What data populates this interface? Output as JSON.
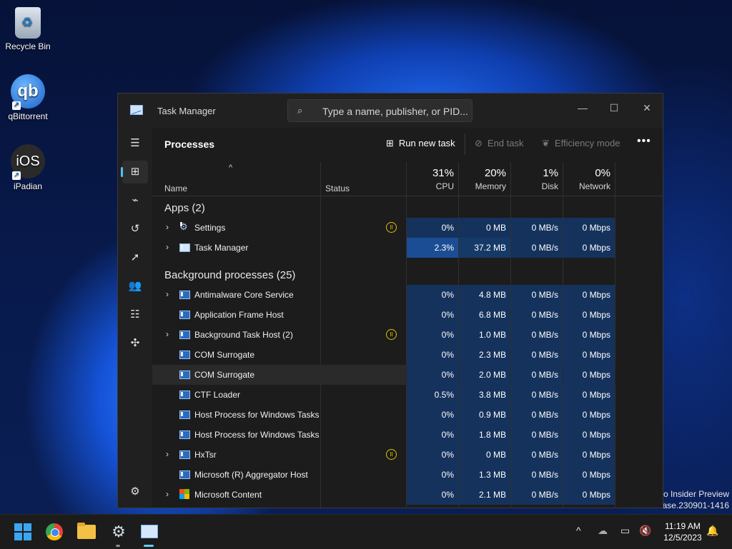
{
  "desktop": {
    "icons": [
      {
        "label": "Recycle Bin"
      },
      {
        "label": "qBittorrent",
        "glyph": "qb"
      },
      {
        "label": "iPadian",
        "glyph": "iOS"
      }
    ],
    "watermark": {
      "line1": "ro Insider Preview",
      "line2": "ease.230901-1416"
    }
  },
  "window": {
    "title": "Task Manager",
    "search_placeholder": "Type a name, publisher, or PID...",
    "controls": {
      "minimize": "—",
      "maximize": "☐",
      "close": "✕"
    }
  },
  "nav": {
    "items": [
      {
        "id": "menu",
        "icon": "hamburger-menu-icon",
        "glyph": "☰"
      },
      {
        "id": "processes",
        "icon": "processes-icon",
        "glyph": "⊞",
        "active": true
      },
      {
        "id": "performance",
        "icon": "performance-icon",
        "glyph": "⌁"
      },
      {
        "id": "app-history",
        "icon": "history-icon",
        "glyph": "↺"
      },
      {
        "id": "startup-apps",
        "icon": "startup-icon",
        "glyph": "➚"
      },
      {
        "id": "users",
        "icon": "users-icon",
        "glyph": "👥"
      },
      {
        "id": "details",
        "icon": "details-list-icon",
        "glyph": "☷"
      },
      {
        "id": "services",
        "icon": "services-puzzle-icon",
        "glyph": "✣"
      },
      {
        "id": "settings",
        "icon": "settings-gear-icon",
        "glyph": "⚙"
      }
    ]
  },
  "toolbar": {
    "page_title": "Processes",
    "run_new_task": "Run new task",
    "end_task": "End task",
    "efficiency_mode": "Efficiency mode",
    "more": "•••"
  },
  "columns": {
    "sort_indicator": "^",
    "name": "Name",
    "status": "Status",
    "cpu": {
      "pct": "31%",
      "label": "CPU"
    },
    "memory": {
      "pct": "20%",
      "label": "Memory"
    },
    "disk": {
      "pct": "1%",
      "label": "Disk"
    },
    "network": {
      "pct": "0%",
      "label": "Network"
    }
  },
  "groups": {
    "apps": "Apps (2)",
    "background": "Background processes (25)"
  },
  "apps": [
    {
      "name": "Settings",
      "expandable": true,
      "icon": "settings-gear-icon",
      "paused": true,
      "cpu": "0%",
      "mem": "0 MB",
      "disk": "0 MB/s",
      "net": "0 Mbps"
    },
    {
      "name": "Task Manager",
      "expandable": true,
      "icon": "task-manager-icon",
      "paused": false,
      "cpu": "2.3%",
      "mem": "37.2 MB",
      "disk": "0 MB/s",
      "net": "0 Mbps"
    }
  ],
  "background": [
    {
      "name": "Antimalware Core Service",
      "expandable": true,
      "paused": false,
      "cpu": "0%",
      "mem": "4.8 MB",
      "disk": "0 MB/s",
      "net": "0 Mbps"
    },
    {
      "name": "Application Frame Host",
      "expandable": false,
      "paused": false,
      "cpu": "0%",
      "mem": "6.8 MB",
      "disk": "0 MB/s",
      "net": "0 Mbps"
    },
    {
      "name": "Background Task Host (2)",
      "expandable": true,
      "paused": true,
      "cpu": "0%",
      "mem": "1.0 MB",
      "disk": "0 MB/s",
      "net": "0 Mbps"
    },
    {
      "name": "COM Surrogate",
      "expandable": false,
      "paused": false,
      "cpu": "0%",
      "mem": "2.3 MB",
      "disk": "0 MB/s",
      "net": "0 Mbps"
    },
    {
      "name": "COM Surrogate",
      "expandable": false,
      "paused": false,
      "cpu": "0%",
      "mem": "2.0 MB",
      "disk": "0 MB/s",
      "net": "0 Mbps"
    },
    {
      "name": "CTF Loader",
      "expandable": false,
      "paused": false,
      "cpu": "0.5%",
      "mem": "3.8 MB",
      "disk": "0 MB/s",
      "net": "0 Mbps"
    },
    {
      "name": "Host Process for Windows Tasks",
      "expandable": false,
      "paused": false,
      "cpu": "0%",
      "mem": "0.9 MB",
      "disk": "0 MB/s",
      "net": "0 Mbps"
    },
    {
      "name": "Host Process for Windows Tasks",
      "expandable": false,
      "paused": false,
      "cpu": "0%",
      "mem": "1.8 MB",
      "disk": "0 MB/s",
      "net": "0 Mbps"
    },
    {
      "name": "HxTsr",
      "expandable": true,
      "paused": true,
      "cpu": "0%",
      "mem": "0 MB",
      "disk": "0 MB/s",
      "net": "0 Mbps"
    },
    {
      "name": "Microsoft (R) Aggregator Host",
      "expandable": false,
      "paused": false,
      "cpu": "0%",
      "mem": "1.3 MB",
      "disk": "0 MB/s",
      "net": "0 Mbps"
    },
    {
      "name": "Microsoft Content",
      "expandable": true,
      "paused": false,
      "cpu": "0%",
      "mem": "2.1 MB",
      "disk": "0 MB/s",
      "net": "0 Mbps"
    }
  ],
  "taskbar": {
    "clock_time": "11:19 AM",
    "clock_date": "12/5/2023",
    "tray_chevron": "^"
  },
  "colors": {
    "accent": "#4cc2ff",
    "heat_low": "#14325c",
    "heat_high": "#1b4d94",
    "paused": "#e2c000"
  }
}
